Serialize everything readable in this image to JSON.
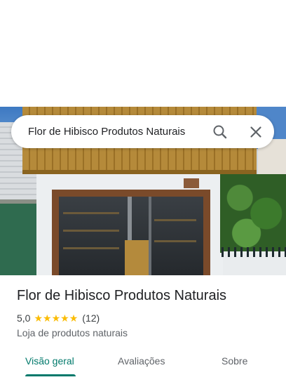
{
  "search": {
    "query": "Flor de Hibisco Produtos Naturais"
  },
  "place": {
    "name": "Flor de Hibisco Produtos Naturais",
    "rating": "5,0",
    "stars": 5,
    "review_count": "(12)",
    "category": "Loja de produtos naturais"
  },
  "tabs": [
    {
      "label": "Visão geral",
      "active": true
    },
    {
      "label": "Avaliações",
      "active": false
    },
    {
      "label": "Sobre",
      "active": false
    }
  ],
  "colors": {
    "accent": "#00796b",
    "star": "#fbbc04"
  },
  "icons": {
    "search": "search-icon",
    "close": "close-icon"
  }
}
